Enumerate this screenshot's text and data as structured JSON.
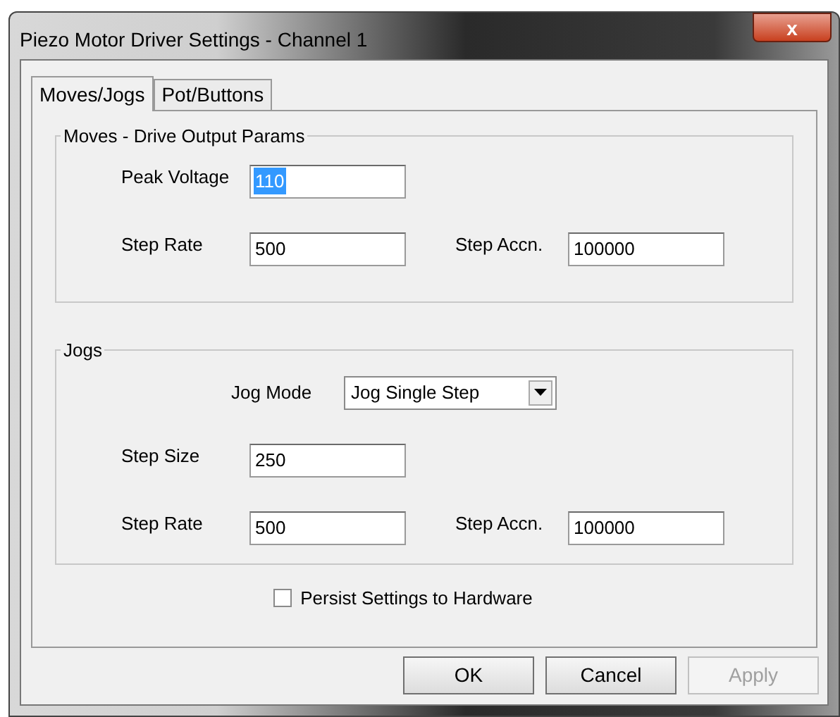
{
  "window": {
    "title": "Piezo Motor Driver Settings - Channel 1",
    "close": "x"
  },
  "tabs": [
    {
      "label": "Moves/Jogs",
      "selected": true
    },
    {
      "label": "Pot/Buttons",
      "selected": false
    }
  ],
  "groups": [
    {
      "title": "Moves - Drive Output Params",
      "rows": [
        [
          {
            "kind": "text",
            "label": "Peak Voltage",
            "value": "110",
            "selected": true
          }
        ],
        [
          {
            "kind": "text",
            "label": "Step Rate",
            "value": "500",
            "selected": false
          },
          {
            "kind": "text",
            "label": "Step Accn.",
            "value": "100000",
            "selected": false
          }
        ]
      ]
    },
    {
      "title": "Jogs",
      "rows": [
        [
          {
            "kind": "dropdown",
            "label": "Jog Mode",
            "value": "Jog Single Step",
            "selected": false
          }
        ],
        [
          {
            "kind": "text",
            "label": "Step Size",
            "value": "250",
            "selected": false
          }
        ],
        [
          {
            "kind": "text",
            "label": "Step Rate",
            "value": "500",
            "selected": false
          },
          {
            "kind": "text",
            "label": "Step Accn.",
            "value": "100000",
            "selected": false
          }
        ]
      ]
    }
  ],
  "persist": {
    "label": "Persist Settings to Hardware",
    "checked": false
  },
  "buttons": [
    {
      "label": "OK",
      "disabled": false
    },
    {
      "label": "Cancel",
      "disabled": false
    },
    {
      "label": "Apply",
      "disabled": true
    }
  ]
}
